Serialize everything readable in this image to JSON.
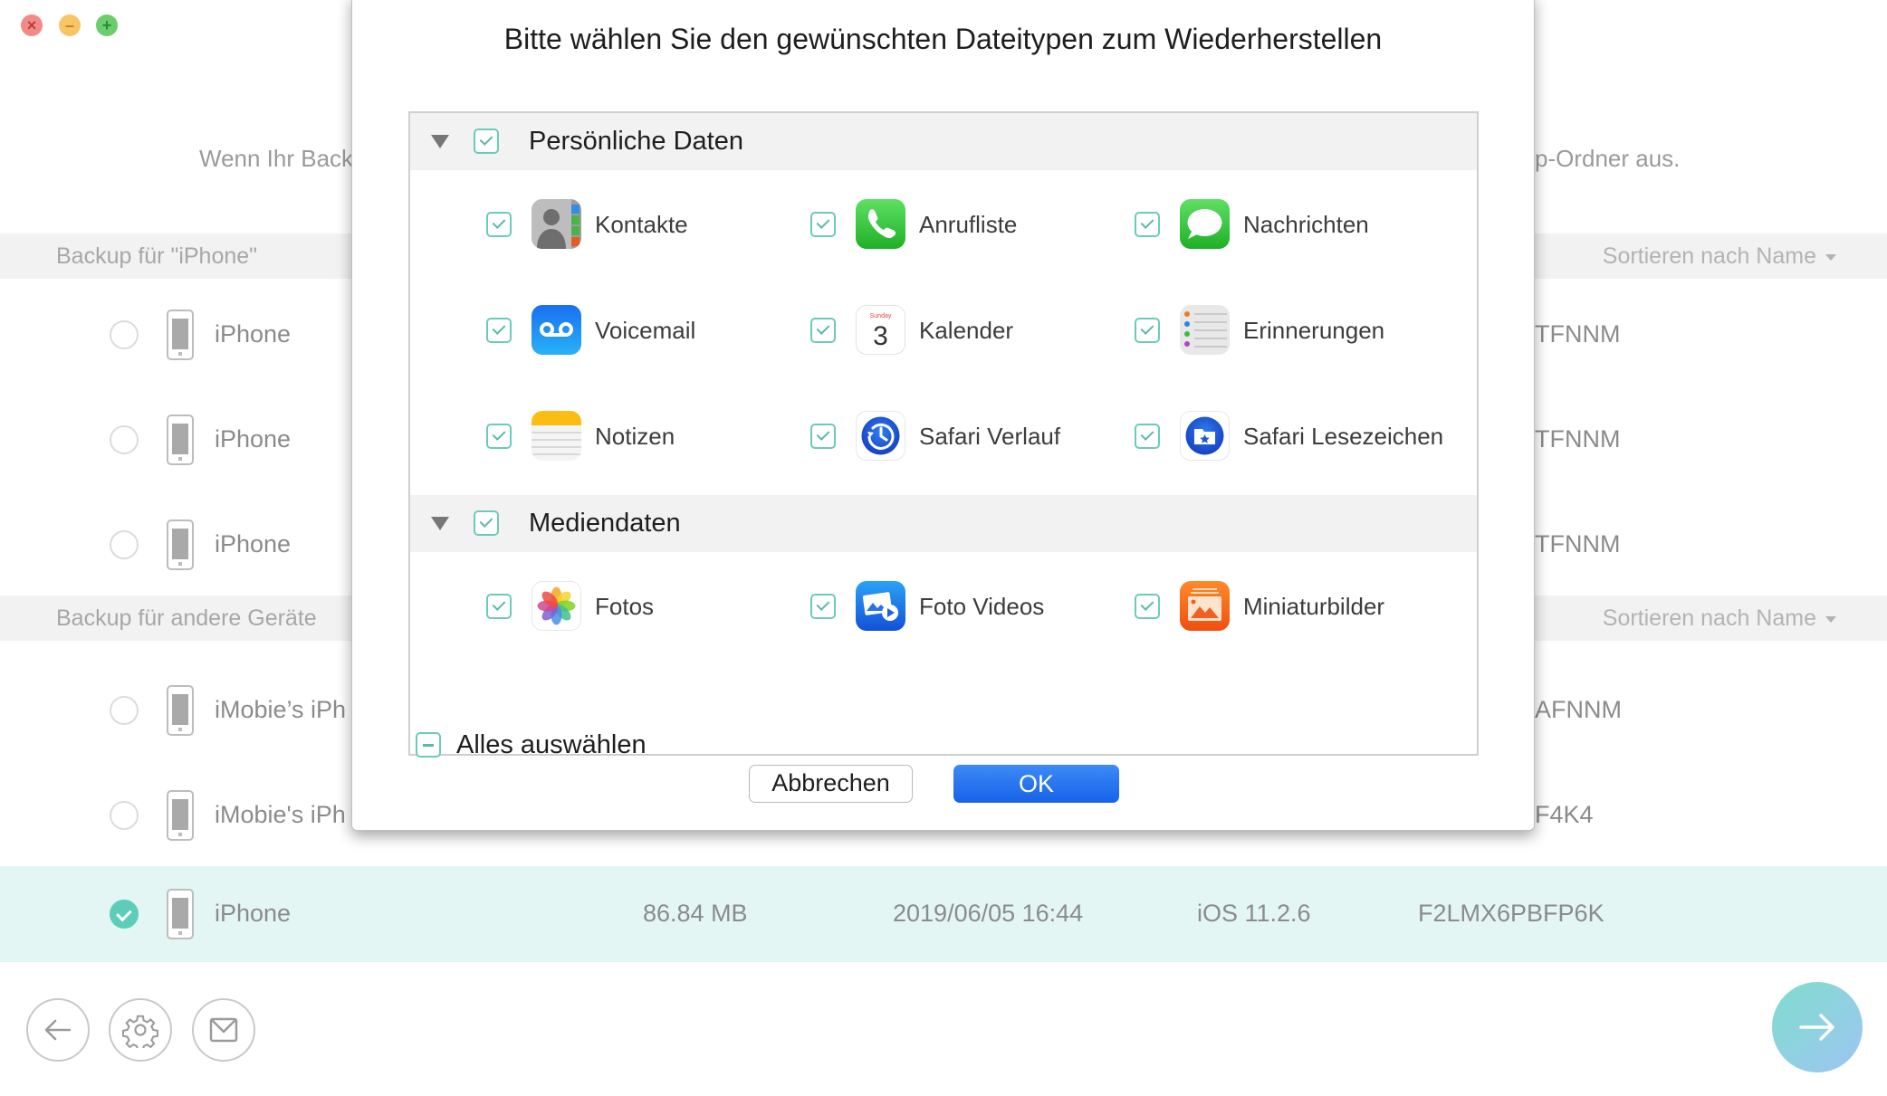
{
  "window": {
    "traffic_lights": [
      "close",
      "minimize",
      "maximize"
    ]
  },
  "background": {
    "hint_left": "Wenn Ihr Back",
    "hint_right": "p-Ordner aus.",
    "sections": [
      {
        "title": "Backup für \"iPhone\"",
        "sort_label": "Sortieren nach Name",
        "rows": [
          {
            "name": "iPhone",
            "trailing": "TFNNM",
            "selected": false
          },
          {
            "name": "iPhone",
            "trailing": "TFNNM",
            "selected": false
          },
          {
            "name": "iPhone",
            "trailing": "TFNNM",
            "selected": false
          }
        ]
      },
      {
        "title": "Backup für andere Geräte",
        "sort_label": "Sortieren nach Name",
        "rows": [
          {
            "name": "iMobie’s iPh",
            "trailing": "AFNNM",
            "selected": false
          },
          {
            "name": "iMobie's iPh",
            "trailing": "F4K4",
            "selected": false
          }
        ]
      }
    ],
    "selected_row": {
      "name": "iPhone",
      "size": "86.84 MB",
      "date": "2019/06/05 16:44",
      "ios": "iOS 11.2.6",
      "serial": "F2LMX6PBFP6K",
      "selected": true
    }
  },
  "toolbar": {
    "back_icon": "arrow-left-icon",
    "settings_icon": "gear-icon",
    "mail_icon": "mail-icon",
    "next_icon": "arrow-right-icon"
  },
  "dialog": {
    "title": "Bitte wählen Sie den gewünschten Dateitypen zum Wiederherstellen",
    "groups": [
      {
        "label": "Persönliche Daten",
        "checked": true,
        "items": [
          {
            "label": "Kontakte",
            "icon": "contacts-icon",
            "checked": true
          },
          {
            "label": "Anrufliste",
            "icon": "phone-icon",
            "checked": true
          },
          {
            "label": "Nachrichten",
            "icon": "messages-icon",
            "checked": true
          },
          {
            "label": "Voicemail",
            "icon": "voicemail-icon",
            "checked": true
          },
          {
            "label": "Kalender",
            "icon": "calendar-icon",
            "checked": true,
            "calendar_day": "3",
            "calendar_weekday": "Sunday"
          },
          {
            "label": "Erinnerungen",
            "icon": "reminders-icon",
            "checked": true
          },
          {
            "label": "Notizen",
            "icon": "notes-icon",
            "checked": true
          },
          {
            "label": "Safari Verlauf",
            "icon": "safari-history-icon",
            "checked": true
          },
          {
            "label": "Safari Lesezeichen",
            "icon": "safari-bookmarks-icon",
            "checked": true
          }
        ]
      },
      {
        "label": "Mediendaten",
        "checked": true,
        "items": [
          {
            "label": "Fotos",
            "icon": "photos-icon",
            "checked": true
          },
          {
            "label": "Foto Videos",
            "icon": "photo-videos-icon",
            "checked": true
          },
          {
            "label": "Miniaturbilder",
            "icon": "thumbnails-icon",
            "checked": true
          }
        ]
      }
    ],
    "select_all_label": "Alles auswählen",
    "select_all_state": "partial",
    "cancel_label": "Abbrechen",
    "ok_label": "OK"
  },
  "colors": {
    "accent_teal": "#5dcdb9",
    "ok_blue": "#1d6ff0",
    "selected_row_bg": "#e3f6f4"
  }
}
